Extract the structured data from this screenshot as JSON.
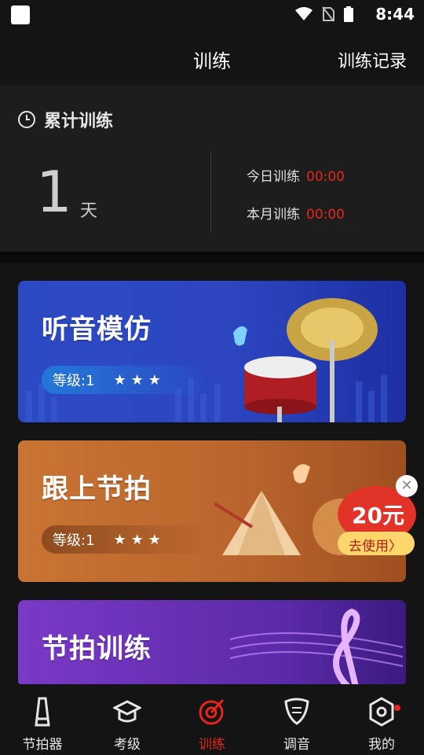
{
  "status": {
    "time": "8:44"
  },
  "header": {
    "title": "训练",
    "record_link": "训练记录"
  },
  "summary": {
    "label": "累计训练",
    "total_value": "1",
    "total_unit": "天",
    "today_label": "今日训练",
    "today_value": "00:00",
    "month_label": "本月训练",
    "month_value": "00:00"
  },
  "cards": [
    {
      "title": "听音模仿",
      "level": "等级:1",
      "stars": "★★★"
    },
    {
      "title": "跟上节拍",
      "level": "等级:1",
      "stars": "★★★"
    },
    {
      "title": "节拍训练"
    }
  ],
  "coupon": {
    "amount": "20元",
    "action": "去使用"
  },
  "tabs": [
    {
      "label": "节拍器",
      "icon": "metronome-icon"
    },
    {
      "label": "考级",
      "icon": "graduation-cap-icon"
    },
    {
      "label": "训练",
      "icon": "target-icon"
    },
    {
      "label": "调音",
      "icon": "tuner-pick-icon"
    },
    {
      "label": "我的",
      "icon": "profile-hex-icon"
    }
  ],
  "colors": {
    "accent": "#e5261c",
    "background": "#141414"
  }
}
